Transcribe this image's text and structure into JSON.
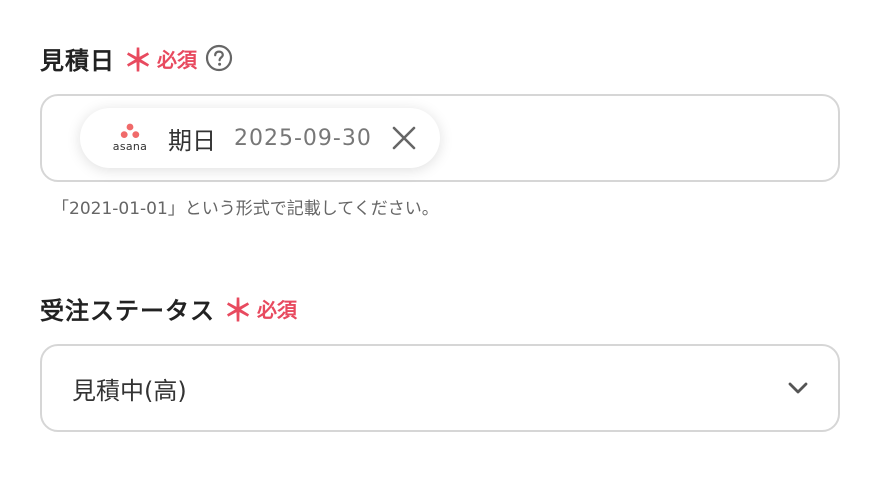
{
  "colors": {
    "required": "#e84a5f",
    "border": "#d6d6d6",
    "asana_brand": "#f06a6a"
  },
  "date_field": {
    "label": "見積日",
    "required_mark": "＊",
    "required_text": "必須",
    "help_icon": "question-circle-icon",
    "chip": {
      "app_icon": "asana-logo",
      "app_name": "asana",
      "label": "期日",
      "value": "2025-09-30",
      "remove_icon": "close-icon"
    },
    "hint": "「2021-01-01」という形式で記載してください。"
  },
  "status_field": {
    "label": "受注ステータス",
    "required_mark": "＊",
    "required_text": "必須",
    "selected_value": "見積中(高)",
    "dropdown_icon": "chevron-down-icon"
  }
}
